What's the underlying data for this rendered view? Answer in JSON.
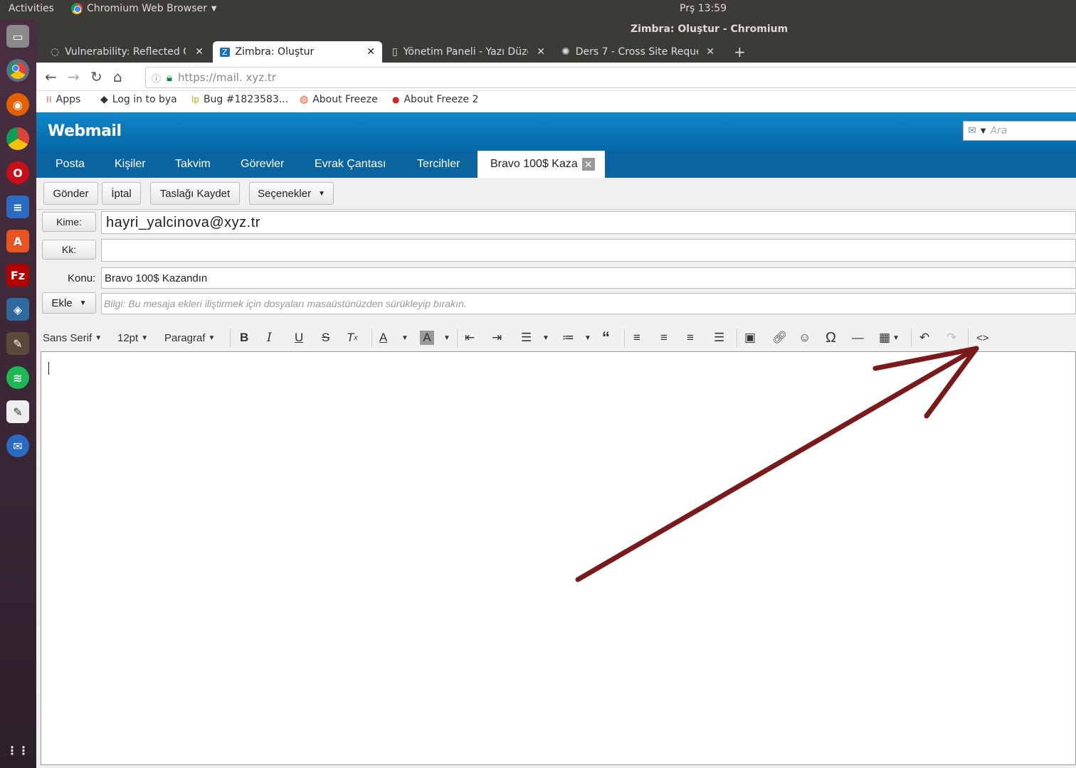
{
  "system": {
    "activities": "Activities",
    "app_name": "Chromium Web Browser",
    "clock": "Prş 13:59"
  },
  "window": {
    "title": "Zimbra: Oluştur - Chromium"
  },
  "tabs": [
    {
      "label": "Vulnerability: Reflected C"
    },
    {
      "label": "Zimbra: Oluştur"
    },
    {
      "label": "Yönetim Paneli - Yazı Düze"
    },
    {
      "label": "Ders 7 - Cross Site Reques"
    }
  ],
  "address": {
    "url": "https://mail. xyz.tr"
  },
  "bookmarks": [
    "Apps",
    "Log in to bya",
    "Bug #1823583...",
    "About Freeze",
    "About Freeze 2"
  ],
  "zimbra": {
    "logo": "Webmail",
    "search_placeholder": "Ara",
    "nav": [
      "Posta",
      "Kişiler",
      "Takvim",
      "Görevler",
      "Evrak Çantası",
      "Tercihler"
    ],
    "active_tab": "Bravo 100$ Kaza",
    "actions": {
      "send": "Gönder",
      "cancel": "İptal",
      "save_draft": "Taslağı Kaydet",
      "options": "Seçenekler"
    },
    "to_label": "Kime:",
    "to_value": "hayri_yalcinova@xyz.tr",
    "cc_label": "Kk:",
    "cc_value": "",
    "subject_label": "Konu:",
    "subject_value": "Bravo 100$ Kazandın",
    "attach_label": "Ekle",
    "attach_hint": "Bilgi: Bu mesaja ekleri iliştirmek için dosyaları masaüstünüzden sürükleyip bırakın.",
    "editor_toolbar": {
      "font": "Sans Serif",
      "size": "12pt",
      "format": "Paragraf"
    }
  },
  "colors": {
    "zimbra_header": "#0f86c9",
    "annotation_arrow": "#7a1a1a"
  }
}
